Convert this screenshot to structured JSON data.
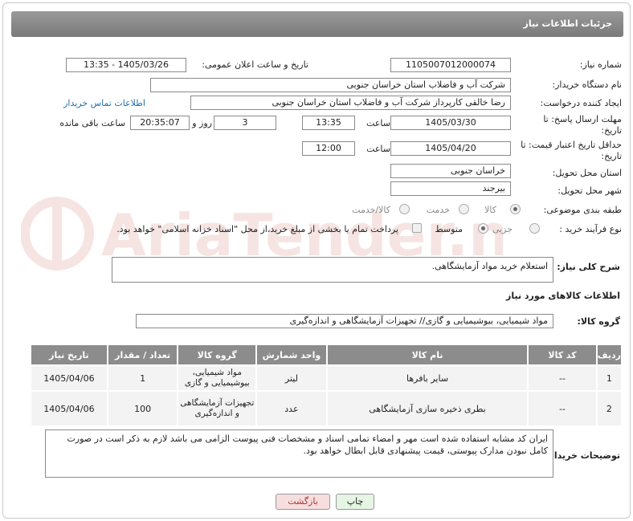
{
  "header": {
    "title": "جزئیات اطلاعات نیاز"
  },
  "form": {
    "need_number_label": "شماره نیاز:",
    "need_number": "1105007012000074",
    "announce_label": "تاریخ و ساعت اعلان عمومی:",
    "announce_value": "1405/03/26 - 13:35",
    "buyer_org_label": "نام دستگاه خریدار:",
    "buyer_org": "شرکت آب و فاضلاب استان خراسان جنوبی",
    "creator_label": "ایجاد کننده درخواست:",
    "creator": "رضا خالقی کارپرداز شرکت آب و فاضلاب استان خراسان جنوبی",
    "buyer_contact_link": "اطلاعات تماس خریدار",
    "deadline_label": "مهلت ارسال پاسخ: تا تاریخ:",
    "deadline_date": "1405/03/30",
    "time_label": "ساعت",
    "deadline_time": "13:35",
    "days_value": "3",
    "days_label": "روز و",
    "remaining_value": "20:35:07",
    "remaining_label": "ساعت باقی مانده",
    "validity_label": "حداقل تاریخ اعتبار قیمت: تا تاریخ:",
    "validity_date": "1405/04/20",
    "validity_time": "12:00",
    "province_label": "استان محل تحویل:",
    "province": "خراسان جنوبی",
    "city_label": "شهر محل تحویل:",
    "city": "بیرجند",
    "category_label": "طبقه بندی موضوعی:",
    "category_options": [
      "کالا",
      "خدمت",
      "کالا/خدمت"
    ],
    "process_label": "نوع فرآیند خرید :",
    "process_options": [
      "جزیی",
      "متوسط"
    ],
    "payment_text": "پرداخت تمام یا بخشی از مبلغ خرید،از محل \"اسناد خزانه اسلامی\" خواهد بود."
  },
  "description": {
    "label": "شرح کلی نیاز:",
    "value": "استعلام خرید مواد آزمایشگاهی."
  },
  "goods_section": {
    "title": "اطلاعات کالاهای مورد نیاز",
    "group_label": "گروه کالا:",
    "group_value": "مواد شیمیایی، بیوشیمیایی و  گازی// تجهیزات آزمایشگاهی و اندازه‌گیری"
  },
  "table": {
    "headers": [
      "ردیف",
      "کد کالا",
      "نام کالا",
      "واحد شمارش",
      "گروه کالا",
      "تعداد / مقدار",
      "تاریخ نیاز"
    ],
    "rows": [
      [
        "1",
        "--",
        "سایر بافرها",
        "لیتر",
        "مواد شیمیایی، بیوشیمیایی و گازی",
        "1",
        "1405/04/06"
      ],
      [
        "2",
        "--",
        "بطری ذخیره سازی آزمایشگاهی",
        "عدد",
        "تجهیزات آزمایشگاهی و اندازه‌گیری",
        "100",
        "1405/04/06"
      ]
    ]
  },
  "buyer_notes": {
    "label": "توضیحات خریدار:",
    "value": "ایران کد مشابه استفاده شده است مهر و امضاء تمامی اسناد و مشخصات فنی پیوست الزامی می باشد لازم به ذکر است در صورت کامل نبودن  مدارک پیوستی،  قیمت پیشنهادی قابل ابطال خواهد بود."
  },
  "buttons": {
    "print": "چاپ",
    "back": "بازگشت"
  },
  "watermark": {
    "text": "AriaTender.net"
  },
  "colors": {
    "title_bar": "#8a8a8a",
    "link": "#1f6fb2",
    "back_button": "#f7dede",
    "print_button": "#e6f5e4",
    "table_header": "#8c8c8c"
  }
}
